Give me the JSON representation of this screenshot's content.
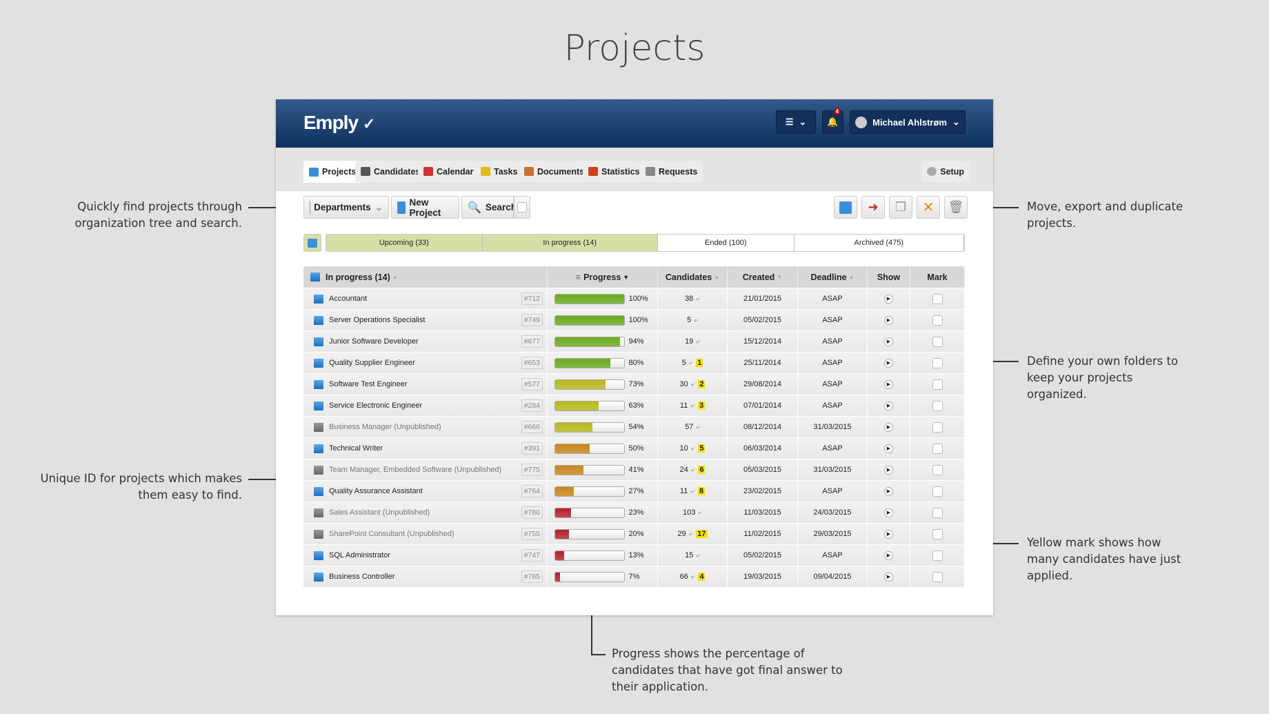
{
  "page_title": "Projects",
  "annotations": {
    "search": "Quickly find projects through organization tree and search.",
    "unique_id": "Unique ID for projects which makes them easy to find.",
    "move": "Move, export and duplicate projects.",
    "folders": "Define your own folders to keep your projects organized.",
    "yellow": "Yellow mark shows how many candidates have just applied.",
    "progress": "Progress shows the percentage of candidates that have got final answer to their application."
  },
  "header": {
    "logo": "Emply",
    "user": "Michael Ahlstrøm",
    "notifications": "4"
  },
  "tabs": [
    "Projects",
    "Candidates",
    "Calendar",
    "Tasks",
    "Documents",
    "Statistics",
    "Requests"
  ],
  "setup": "Setup",
  "toolbar": {
    "departments": "Departments",
    "new_project": "New Project",
    "search": "Search"
  },
  "status": [
    {
      "label": "Upcoming (33)",
      "active": true
    },
    {
      "label": "In progress (14)",
      "active": true
    },
    {
      "label": "Ended (100)",
      "active": false
    },
    {
      "label": "Archived (475)",
      "active": false
    }
  ],
  "table": {
    "columns": [
      "In progress (14)",
      "Progress",
      "Candidates",
      "Created",
      "Deadline",
      "Show",
      "Mark"
    ],
    "rows": [
      {
        "name": "Accountant",
        "id": "#712",
        "progress": 100,
        "candidates": "38",
        "new": "",
        "created": "21/01/2015",
        "deadline": "ASAP",
        "published": true
      },
      {
        "name": "Server Operations Specialist",
        "id": "#749",
        "progress": 100,
        "candidates": "5",
        "new": "",
        "created": "05/02/2015",
        "deadline": "ASAP",
        "published": true
      },
      {
        "name": "Junior Software Developer",
        "id": "#677",
        "progress": 94,
        "candidates": "19",
        "new": "",
        "created": "15/12/2014",
        "deadline": "ASAP",
        "published": true
      },
      {
        "name": "Quality Supplier Engineer",
        "id": "#653",
        "progress": 80,
        "candidates": "5",
        "new": "1",
        "created": "25/11/2014",
        "deadline": "ASAP",
        "published": true
      },
      {
        "name": "Software Test Engineer",
        "id": "#577",
        "progress": 73,
        "candidates": "30",
        "new": "2",
        "created": "29/08/2014",
        "deadline": "ASAP",
        "published": true
      },
      {
        "name": "Service Electronic Engineer",
        "id": "#284",
        "progress": 63,
        "candidates": "11",
        "new": "3",
        "created": "07/01/2014",
        "deadline": "ASAP",
        "published": true
      },
      {
        "name": "Business Manager (Unpublished)",
        "id": "#666",
        "progress": 54,
        "candidates": "57",
        "new": "",
        "created": "08/12/2014",
        "deadline": "31/03/2015",
        "published": false
      },
      {
        "name": "Technical Writer",
        "id": "#391",
        "progress": 50,
        "candidates": "10",
        "new": "5",
        "created": "06/03/2014",
        "deadline": "ASAP",
        "published": true
      },
      {
        "name": "Team Manager, Embedded Software (Unpublished)",
        "id": "#775",
        "progress": 41,
        "candidates": "24",
        "new": "6",
        "created": "05/03/2015",
        "deadline": "31/03/2015",
        "published": false
      },
      {
        "name": "Quality Assurance Assistant",
        "id": "#764",
        "progress": 27,
        "candidates": "11",
        "new": "8",
        "created": "23/02/2015",
        "deadline": "ASAP",
        "published": true
      },
      {
        "name": "Sales Assistant (Unpublished)",
        "id": "#780",
        "progress": 23,
        "candidates": "103",
        "new": "",
        "created": "11/03/2015",
        "deadline": "24/03/2015",
        "published": false
      },
      {
        "name": "SharePoint Consultant (Unpublished)",
        "id": "#755",
        "progress": 20,
        "candidates": "29",
        "new": "17",
        "created": "11/02/2015",
        "deadline": "29/03/2015",
        "published": false
      },
      {
        "name": "SQL Administrator",
        "id": "#747",
        "progress": 13,
        "candidates": "15",
        "new": "",
        "created": "05/02/2015",
        "deadline": "ASAP",
        "published": true
      },
      {
        "name": "Business Controller",
        "id": "#785",
        "progress": 7,
        "candidates": "66",
        "new": "4",
        "created": "19/03/2015",
        "deadline": "09/04/2015",
        "published": true
      }
    ]
  },
  "colors": {
    "header": "#1b3f6e",
    "green": "#6aaa1a",
    "olive": "#b8b81a",
    "orange": "#c8861a",
    "red": "#b3202a",
    "yellow_mark": "#f5e100"
  }
}
